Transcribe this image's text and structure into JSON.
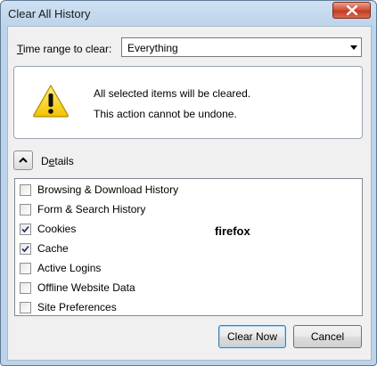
{
  "window": {
    "title": "Clear All History"
  },
  "time_range": {
    "label_underlined": "T",
    "label_rest": "ime range to clear:",
    "selected": "Everything"
  },
  "warning": {
    "line1": "All selected items will be cleared.",
    "line2": "This action cannot be undone."
  },
  "details": {
    "label_pre": "D",
    "label_underlined": "e",
    "label_rest": "tails"
  },
  "items": [
    {
      "label": "Browsing & Download History",
      "checked": false
    },
    {
      "label": "Form & Search History",
      "checked": false
    },
    {
      "label": "Cookies",
      "checked": true
    },
    {
      "label": "Cache",
      "checked": true
    },
    {
      "label": "Active Logins",
      "checked": false
    },
    {
      "label": "Offline Website Data",
      "checked": false
    },
    {
      "label": "Site Preferences",
      "checked": false
    }
  ],
  "annotation": "firefox",
  "buttons": {
    "clear_now": "Clear Now",
    "cancel": "Cancel"
  },
  "icons": {
    "close": "close-icon",
    "dropdown": "chevron-down-icon",
    "warning": "warning-icon",
    "collapse": "chevron-up-icon",
    "checkmark": "checkmark-icon"
  }
}
